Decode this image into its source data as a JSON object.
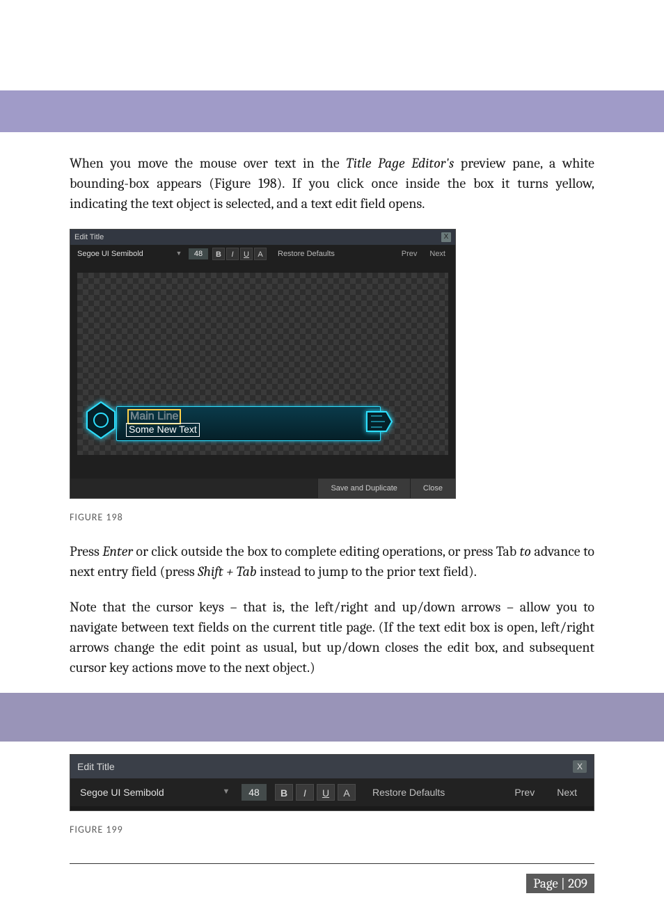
{
  "paragraphs": {
    "p1_a": "When you move the mouse over text in the ",
    "p1_b": "Title Page Editor's",
    "p1_c": " preview pane, a white bounding-box appears (Figure 198). If you click once inside the box it turns yellow, indicating the text object is selected, and a text edit field opens.",
    "p2_a": "Press ",
    "p2_b": "Enter",
    "p2_c": " or click outside the box to complete editing operations, or press Tab ",
    "p2_d": "to",
    "p2_e": " advance to next entry field (press ",
    "p2_f": "Shift + Tab",
    "p2_g": " instead to jump to the prior text field).",
    "p3": "Note that the cursor keys – that is, the left/right and up/down arrows – allow you to navigate between text fields on the current title page.  (If the text edit box is open, left/right arrows change the edit point as usual, but up/down closes the edit box, and subsequent cursor key actions move to the next object.)"
  },
  "figure198": {
    "window_title": "Edit Title",
    "close_glyph": "X",
    "font_name": "Segoe UI Semibold",
    "dropdown_glyph": "▼",
    "font_size": "48",
    "btn_bold": "B",
    "btn_italic": "I",
    "btn_underline": "U",
    "btn_color": "A",
    "restore_label": "Restore Defaults",
    "prev_label": "Prev",
    "next_label": "Next",
    "lower_third_main": "Main Line",
    "lower_third_sub": "Some New Text",
    "save_dup_label": "Save and Duplicate",
    "close_btn_label": "Close",
    "caption": "FIGURE 198"
  },
  "figure199": {
    "window_title": "Edit Title",
    "close_glyph": "X",
    "font_name": "Segoe UI Semibold",
    "dropdown_glyph": "▼",
    "font_size": "48",
    "btn_bold": "B",
    "btn_italic": "I",
    "btn_underline": "U",
    "btn_color": "A",
    "restore_label": "Restore Defaults",
    "prev_label": "Prev",
    "next_label": "Next",
    "caption": "FIGURE 199"
  },
  "footer": {
    "label": "Page | ",
    "number": "209"
  }
}
